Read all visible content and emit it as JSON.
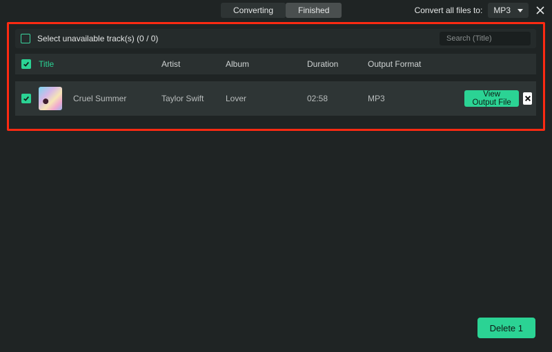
{
  "tabs": {
    "converting": "Converting",
    "finished": "Finished",
    "active": "finished"
  },
  "topbar": {
    "convert_label": "Convert all files to:",
    "format_selected": "MP3"
  },
  "toolbar": {
    "select_unavailable_label": "Select unavailable track(s) (0 / 0)",
    "search_placeholder": "Search (Title)"
  },
  "columns": {
    "title": "Title",
    "artist": "Artist",
    "album": "Album",
    "duration": "Duration",
    "format": "Output Format"
  },
  "tracks": [
    {
      "title": "Cruel Summer",
      "artist": "Taylor Swift",
      "album": "Lover",
      "duration": "02:58",
      "format": "MP3",
      "view_label": "View Output File"
    }
  ],
  "footer": {
    "delete_label": "Delete 1"
  }
}
